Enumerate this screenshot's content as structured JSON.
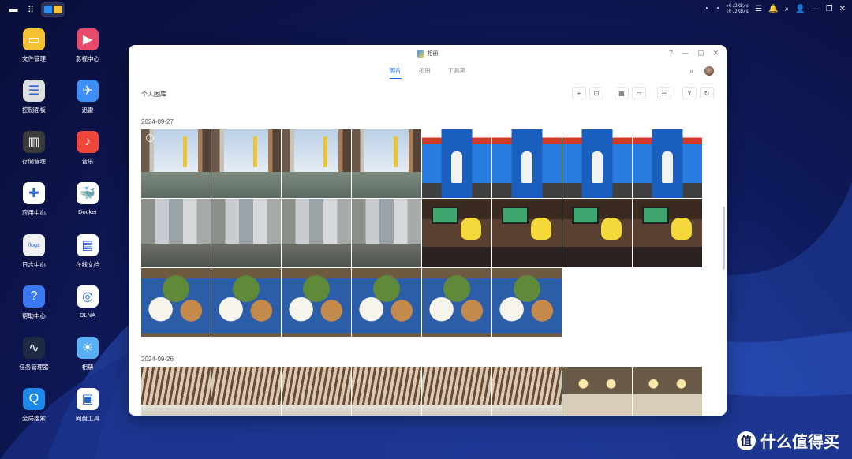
{
  "taskbar": {
    "speed_up": "↑0.2KB/s",
    "speed_down": "↓0.2KB/s"
  },
  "desktop": {
    "icons": [
      {
        "label": "文件管理",
        "icon": "folder-icon",
        "color": "#f4c232",
        "glyph": "▭"
      },
      {
        "label": "影视中心",
        "icon": "video-icon",
        "color": "#e84a6c",
        "glyph": "▶"
      },
      {
        "label": "控制面板",
        "icon": "control-panel-icon",
        "color": "#dedede",
        "glyph": "☰"
      },
      {
        "label": "迅雷",
        "icon": "thunder-icon",
        "color": "#3d8ff5",
        "glyph": "✈"
      },
      {
        "label": "存储管理",
        "icon": "storage-icon",
        "color": "#3a3a3a",
        "glyph": "▥"
      },
      {
        "label": "音乐",
        "icon": "music-icon",
        "color": "#f0463a",
        "glyph": "♪"
      },
      {
        "label": "应用中心",
        "icon": "app-center-icon",
        "color": "#ffffff",
        "glyph": "✚"
      },
      {
        "label": "Docker",
        "icon": "docker-icon",
        "color": "#ffffff",
        "glyph": "🐳"
      },
      {
        "label": "日志中心",
        "icon": "logs-icon",
        "color": "#eef0f4",
        "glyph": "/logs"
      },
      {
        "label": "在线文档",
        "icon": "document-icon",
        "color": "#ffffff",
        "glyph": "▤"
      },
      {
        "label": "帮助中心",
        "icon": "help-icon",
        "color": "#3a78f2",
        "glyph": "?"
      },
      {
        "label": "DLNA",
        "icon": "dlna-icon",
        "color": "#ffffff",
        "glyph": "◎"
      },
      {
        "label": "任务管理器",
        "icon": "task-manager-icon",
        "color": "#1e2a44",
        "glyph": "∿"
      },
      {
        "label": "相册",
        "icon": "photos-icon",
        "color": "#5ab0f5",
        "glyph": "☀"
      },
      {
        "label": "全局搜索",
        "icon": "global-search-icon",
        "color": "#1d88e8",
        "glyph": "Q"
      },
      {
        "label": "网盘工具",
        "icon": "cloud-drive-icon",
        "color": "#ffffff",
        "glyph": "▣"
      }
    ]
  },
  "window": {
    "title": "相册",
    "controls": [
      "?",
      "—",
      "▢",
      "✕"
    ],
    "tabs": [
      {
        "label": "照片",
        "active": true
      },
      {
        "label": "相册",
        "active": false
      },
      {
        "label": "工具箱",
        "active": false
      }
    ],
    "page_title": "个人图库",
    "toolbar": [
      {
        "name": "add",
        "glyph": "+"
      },
      {
        "name": "scan",
        "glyph": "⊡"
      },
      {
        "name": "grid-view",
        "glyph": "▦"
      },
      {
        "name": "folder",
        "glyph": "▱"
      },
      {
        "name": "list",
        "glyph": "☰"
      },
      {
        "name": "filter",
        "glyph": "⊻"
      },
      {
        "name": "refresh",
        "glyph": "↻"
      }
    ],
    "sections": [
      {
        "date": "2024-09-27",
        "photos": [
          "canal",
          "canal",
          "canal",
          "canal",
          "glico",
          "glico",
          "glico",
          "glico",
          "street",
          "street",
          "street",
          "street",
          "stage",
          "stage",
          "stage",
          "stage",
          "food",
          "food",
          "food",
          "food",
          "food",
          "food"
        ]
      },
      {
        "date": "2024-09-26",
        "photos": [
          "arcade",
          "arcade",
          "arcade",
          "arcade",
          "arcade",
          "arcade",
          "lobby",
          "lobby"
        ]
      }
    ]
  },
  "watermark": {
    "text": "什么值得买",
    "logo": "值"
  }
}
